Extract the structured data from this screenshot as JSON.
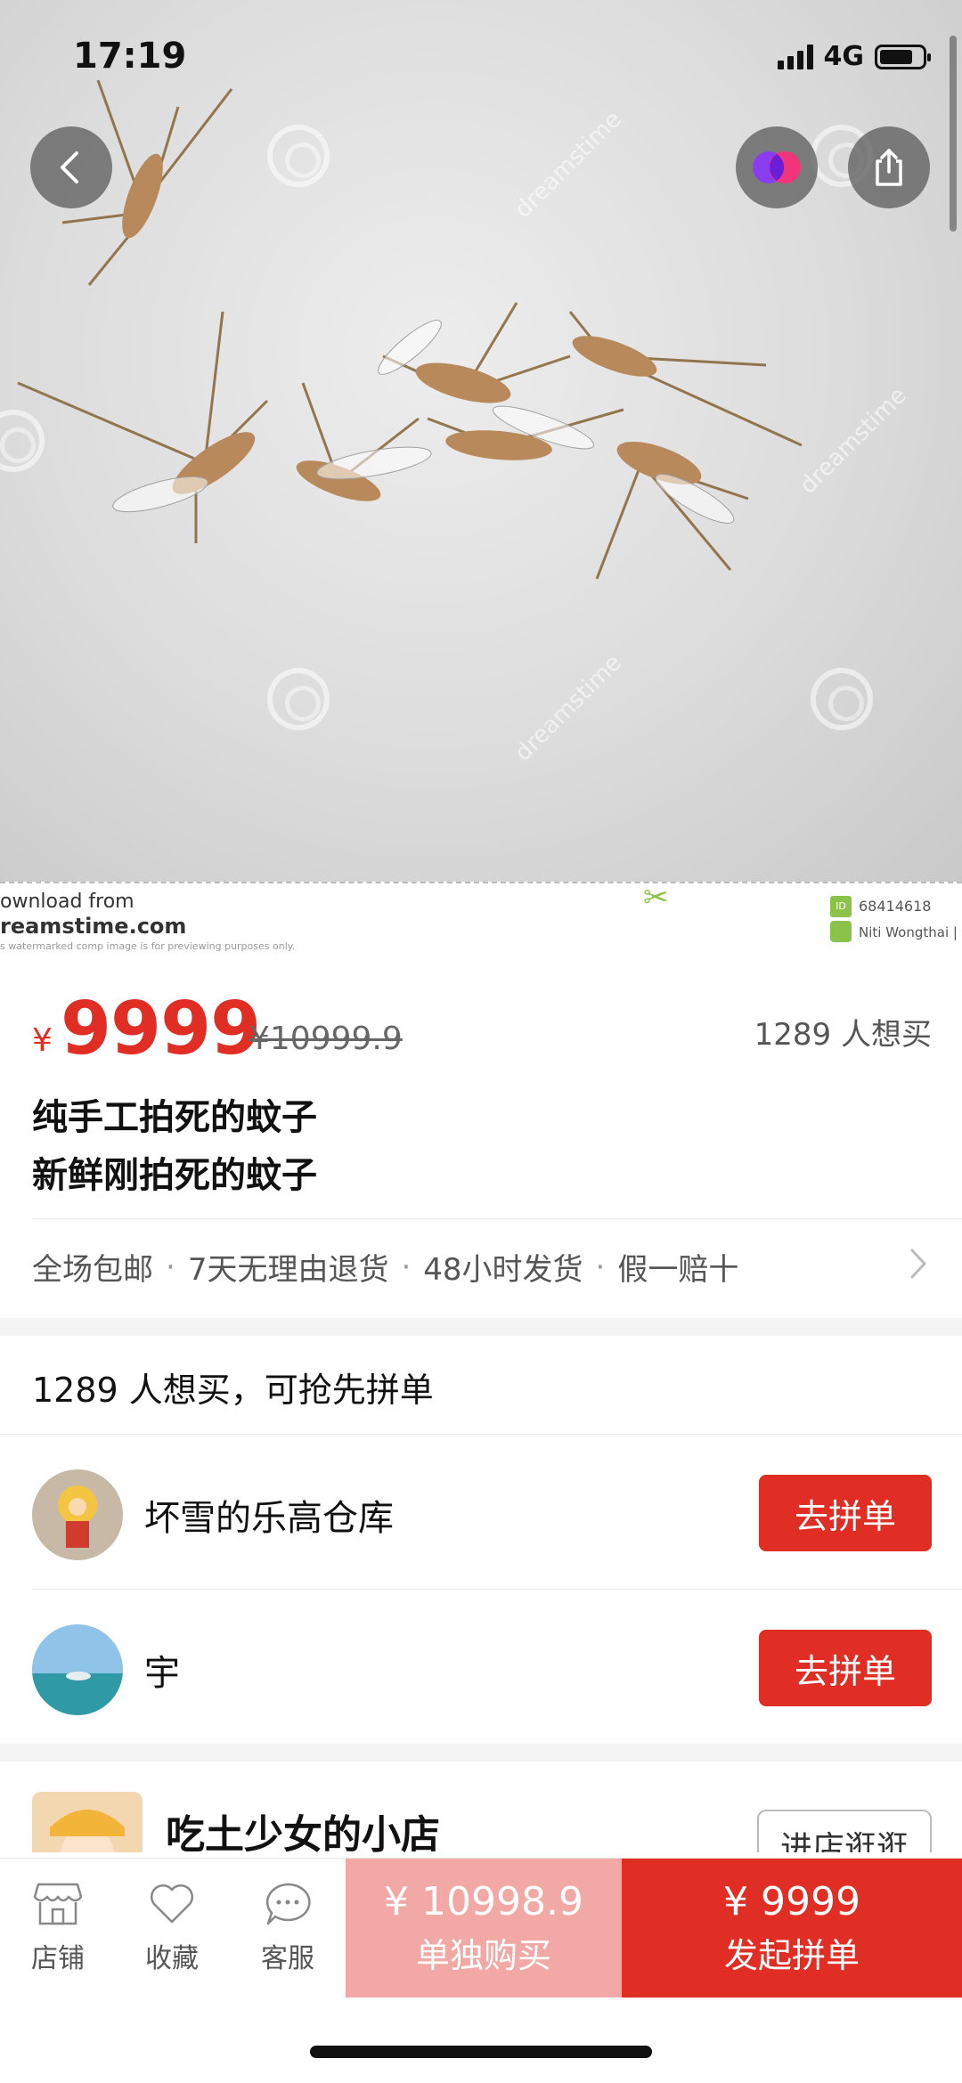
{
  "status_bar": {
    "time": "17:19",
    "network": "4G"
  },
  "hero": {
    "watermark_text": "dreamstime",
    "credit_line1": "ownload from",
    "credit_line2": "reamstime.com",
    "credit_line3": "s watermarked comp image is for previewing purposes only.",
    "id_badge": "ID",
    "id_number": "68414618",
    "photographer": "Niti Wongthai | Dr"
  },
  "product": {
    "currency_symbol": "¥",
    "price": "9999",
    "original_price": "¥10999.9",
    "want_count": "1289 人想买",
    "title_line1": "纯手工拍死的蚊子",
    "title_line2": "新鲜刚拍死的蚊子"
  },
  "guarantees": [
    "全场包邮",
    "7天无理由退货",
    "48小时发货",
    "假一赔十"
  ],
  "group_buy": {
    "header": "1289 人想买，可抢先拼单",
    "rows": [
      {
        "name": "坏雪的乐高仓库",
        "button": "去拼单"
      },
      {
        "name": "宇",
        "button": "去拼单"
      }
    ]
  },
  "shop": {
    "name": "吃土少女的小店",
    "visit_button": "进店逛逛"
  },
  "bottom_bar": {
    "tabs": [
      "店铺",
      "收藏",
      "客服"
    ],
    "single": {
      "price": "¥ 10998.9",
      "label": "单独购买"
    },
    "group": {
      "price": "¥ 9999",
      "label": "发起拼单"
    }
  },
  "colors": {
    "accent": "#e02e24",
    "single_buy_bg": "#f2a8a4",
    "text_dark": "#111111",
    "text_gray": "#555555"
  }
}
